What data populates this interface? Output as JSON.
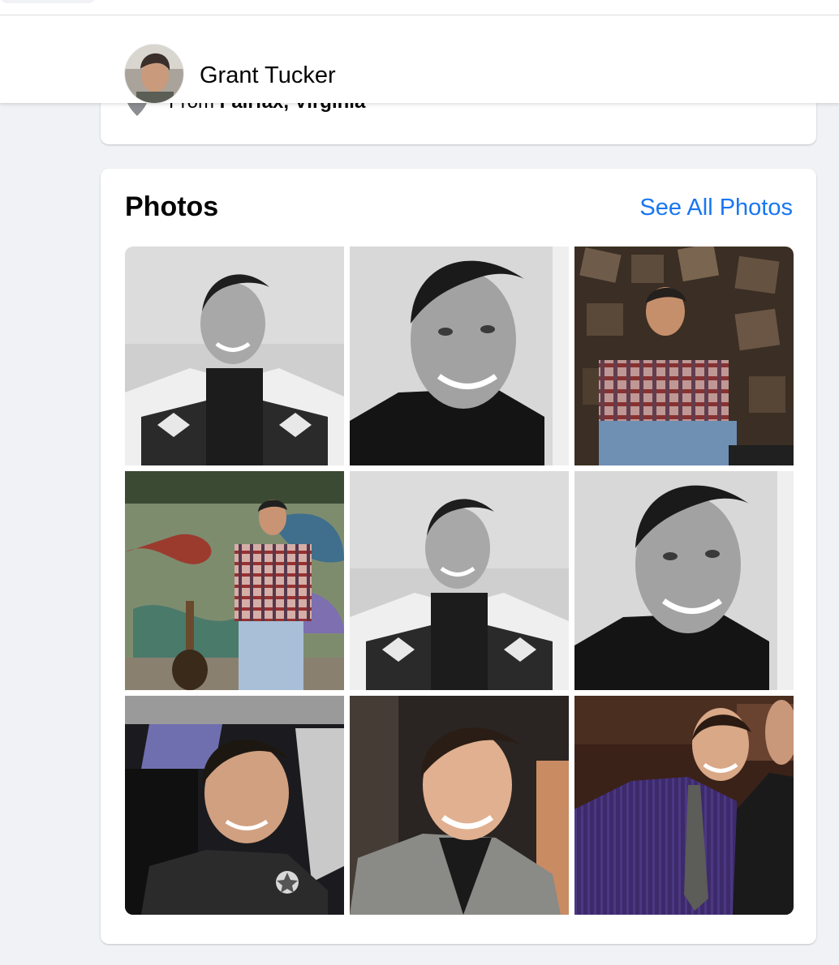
{
  "header": {
    "name": "Grant Tucker",
    "avatar_icon": "profile-avatar"
  },
  "intro": {
    "location_icon": "map-pin-icon",
    "prefix": "From ",
    "place": "Fairfax, Virginia"
  },
  "photos": {
    "title": "Photos",
    "see_all_label": "See All Photos",
    "link_color": "#1877f2",
    "items": [
      {
        "label": "Black and white selfie in patterned cardigan"
      },
      {
        "label": "Black and white close-up smiling in black v-neck"
      },
      {
        "label": "Sitting on wooden blocks in plaid shirt"
      },
      {
        "label": "Standing by graffiti wall with guitar"
      },
      {
        "label": "Black and white selfie in patterned cardigan"
      },
      {
        "label": "Black and white close-up smiling in black v-neck"
      },
      {
        "label": "Selfie in car wearing uniform with badge"
      },
      {
        "label": "Smiling close-up in grey jacket"
      },
      {
        "label": "Group photo in purple shirt and tie"
      }
    ]
  },
  "colors": {
    "page_background": "#f0f2f5",
    "card_background": "#ffffff",
    "accent": "#1877f2"
  }
}
